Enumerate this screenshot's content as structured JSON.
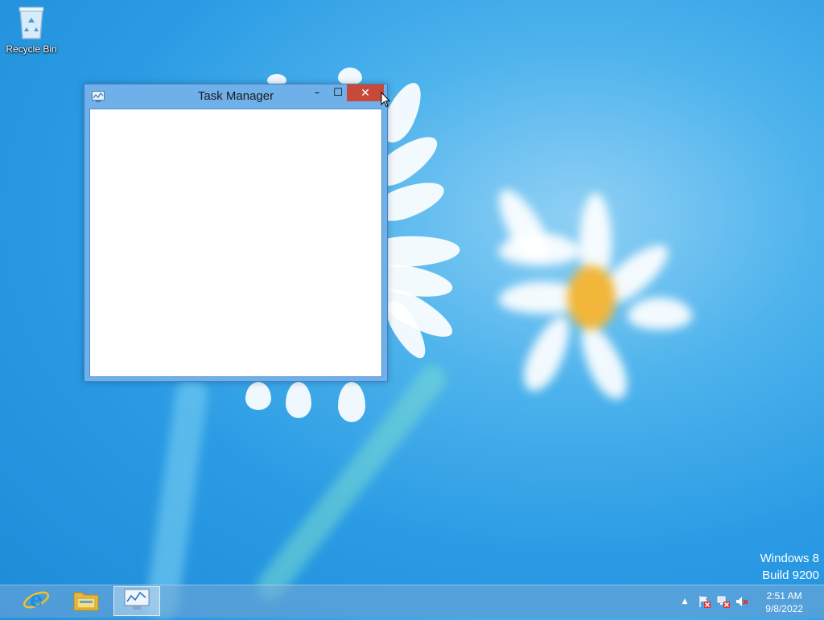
{
  "desktop": {
    "icons": [
      {
        "label": "Recycle Bin",
        "icon": "recycle-bin-icon"
      }
    ],
    "watermark": {
      "line1": "Windows 8",
      "line2": "Build 9200"
    }
  },
  "window": {
    "title": "Task Manager",
    "icon": "task-manager-icon",
    "controls": {
      "minimize": "–",
      "maximize": "☐",
      "close": "✕"
    }
  },
  "taskbar": {
    "pinned": [
      {
        "name": "internet-explorer",
        "icon": "internet-explorer-icon"
      },
      {
        "name": "file-explorer",
        "icon": "folder-icon"
      },
      {
        "name": "task-manager",
        "icon": "task-manager-icon",
        "active": true
      }
    ],
    "tray": {
      "show_hidden": "▲",
      "icons": [
        "action-center-flag-icon",
        "network-error-icon",
        "volume-muted-icon"
      ]
    },
    "clock": {
      "time": "2:51 AM",
      "date": "9/8/2022"
    }
  },
  "colors": {
    "close_button": "#c7493a",
    "window_frame": "#6fb0ea",
    "desktop_blue": "#2a9be4"
  }
}
